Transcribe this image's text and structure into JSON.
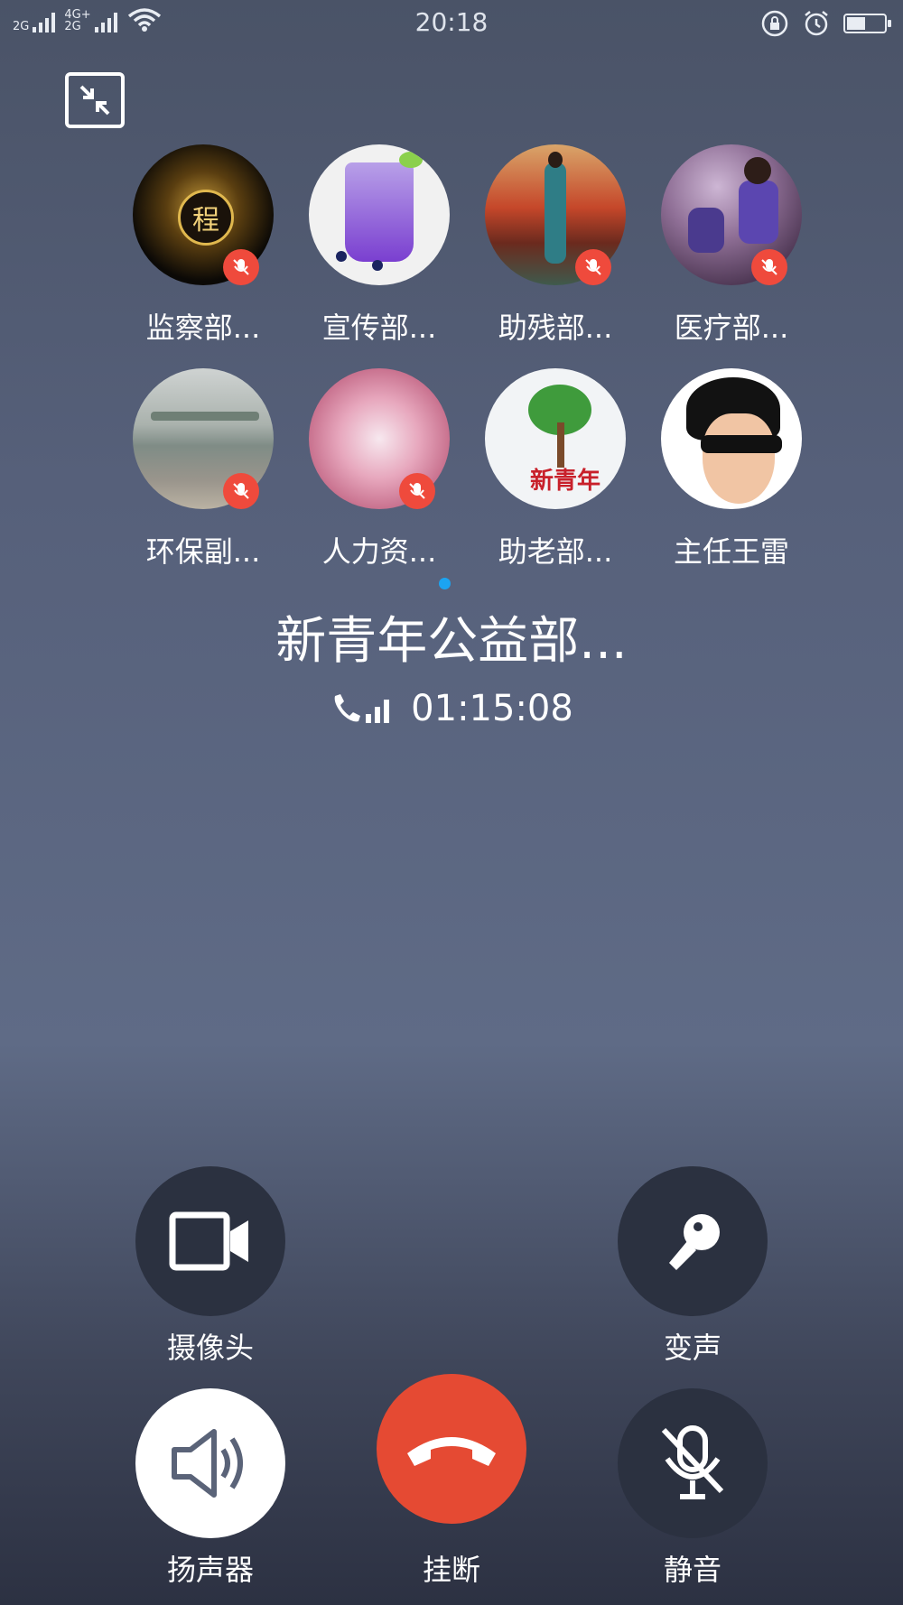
{
  "status_bar": {
    "network_1": "2G",
    "network_2": "4G+",
    "network_3": "2G",
    "time": "20:18",
    "battery_level": 0.45
  },
  "call": {
    "group_name": "新青年公益部...",
    "duration": "01:15:08"
  },
  "members": [
    {
      "name": "监察部...",
      "muted": true
    },
    {
      "name": "宣传部...",
      "muted": false
    },
    {
      "name": "助残部...",
      "muted": true
    },
    {
      "name": "医疗部...",
      "muted": true
    },
    {
      "name": "环保副...",
      "muted": true
    },
    {
      "name": "人力资...",
      "muted": true
    },
    {
      "name": "助老部...",
      "muted": false
    },
    {
      "name": "主任王雷",
      "muted": false
    }
  ],
  "avatar_logos": {
    "logo_1": "程",
    "logo_7": "新青年"
  },
  "controls": {
    "camera": "摄像头",
    "voice_changer": "变声",
    "speaker": "扬声器",
    "hangup": "挂断",
    "mute": "静音"
  },
  "colors": {
    "hangup": "#e54a33",
    "mute_badge": "#ef4a3c",
    "page_dot": "#1ba4f2"
  }
}
